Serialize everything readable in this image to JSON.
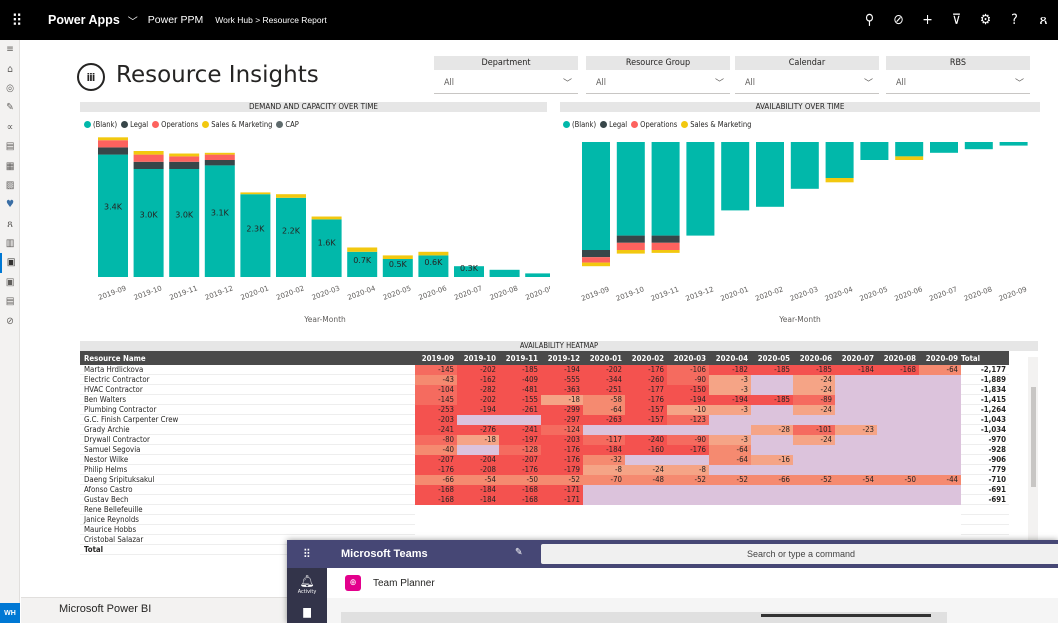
{
  "topbar": {
    "app_name": "Power Apps",
    "app_chevron": "chevron-down-icon",
    "env_name": "Power PPM",
    "breadcrumb": "Work Hub > Resource Report",
    "icons": [
      "search-icon",
      "status-icon",
      "add-icon",
      "filter-icon",
      "gear-icon",
      "help-icon",
      "user-icon"
    ]
  },
  "leftnav": {
    "icons": [
      "hamburger-icon",
      "home-icon",
      "recent-icon",
      "edit-icon",
      "connections-icon",
      "list-icon",
      "grid-icon",
      "image-icon",
      "heart-icon",
      "person-icon",
      "report-icon",
      "report-icon-active",
      "report-icon-2",
      "doc-icon",
      "check-icon"
    ],
    "avatar": "WH"
  },
  "report": {
    "title": "Resource Insights",
    "filters": [
      {
        "label": "Department",
        "value": "All"
      },
      {
        "label": "Resource Group",
        "value": "All"
      },
      {
        "label": "Calendar",
        "value": "All"
      },
      {
        "label": "RBS",
        "value": "All"
      }
    ]
  },
  "colors": {
    "blank": "#01b8aa",
    "legal": "#374649",
    "operations": "#fd625e",
    "sales": "#f2c80f",
    "cap": "#5f6b6d"
  },
  "chart_data": [
    {
      "type": "bar",
      "title": "DEMAND AND CAPACITY OVER TIME",
      "xlabel": "Year-Month",
      "legend": [
        "(Blank)",
        "Legal",
        "Operations",
        "Sales & Marketing",
        "CAP"
      ],
      "categories": [
        "2019-09",
        "2019-10",
        "2019-11",
        "2019-12",
        "2020-01",
        "2020-02",
        "2020-03",
        "2020-04",
        "2020-05",
        "2020-06",
        "2020-07",
        "2020-08",
        "2020-09"
      ],
      "series": [
        {
          "name": "(Blank)",
          "values": [
            3.4,
            3.0,
            3.0,
            3.1,
            2.3,
            2.2,
            1.6,
            0.7,
            0.5,
            0.6,
            0.3,
            0.2,
            0.1
          ]
        },
        {
          "name": "Legal",
          "values": [
            0.2,
            0.2,
            0.2,
            0.15,
            0,
            0,
            0,
            0,
            0,
            0,
            0,
            0,
            0
          ]
        },
        {
          "name": "Operations",
          "values": [
            0.2,
            0.2,
            0.15,
            0.15,
            0,
            0,
            0,
            0,
            0,
            0,
            0,
            0,
            0
          ]
        },
        {
          "name": "Sales & Marketing",
          "values": [
            0.08,
            0.1,
            0.08,
            0.05,
            0.05,
            0.1,
            0.08,
            0.12,
            0.1,
            0.1,
            0,
            0,
            0
          ]
        }
      ],
      "data_labels": [
        "3.4K",
        "3.0K",
        "3.0K",
        "3.1K",
        "2.3K",
        "2.2K",
        "1.6K",
        "0.7K",
        "0.5K",
        "0.6K",
        "0.3K",
        "",
        ""
      ]
    },
    {
      "type": "bar",
      "title": "AVAILABILITY OVER TIME",
      "xlabel": "Year-Month",
      "legend": [
        "(Blank)",
        "Legal",
        "Operations",
        "Sales & Marketing"
      ],
      "categories": [
        "2019-09",
        "2019-10",
        "2019-11",
        "2019-12",
        "2020-01",
        "2020-02",
        "2020-03",
        "2020-04",
        "2020-05",
        "2020-06",
        "2020-07",
        "2020-08",
        "2020-09"
      ],
      "series": [
        {
          "name": "(Blank)",
          "values": [
            -3.0,
            -2.6,
            -2.6,
            -2.6,
            -1.9,
            -1.8,
            -1.3,
            -1.0,
            -0.5,
            -0.4,
            -0.3,
            -0.2,
            -0.1
          ]
        },
        {
          "name": "Legal",
          "values": [
            -0.2,
            -0.2,
            -0.2,
            0,
            0,
            0,
            0,
            0,
            0,
            0,
            0,
            0,
            0
          ]
        },
        {
          "name": "Operations",
          "values": [
            -0.15,
            -0.2,
            -0.2,
            0,
            0,
            0,
            0,
            0,
            0,
            0,
            0,
            0,
            0
          ]
        },
        {
          "name": "Sales & Marketing",
          "values": [
            -0.1,
            -0.1,
            -0.08,
            0,
            0,
            0,
            0,
            -0.12,
            0,
            -0.1,
            0,
            0,
            0
          ]
        }
      ]
    }
  ],
  "heatmap": {
    "title": "AVAILABILITY HEATMAP",
    "header_name": "Resource Name",
    "months": [
      "2019-09",
      "2019-10",
      "2019-11",
      "2019-12",
      "2020-01",
      "2020-02",
      "2020-03",
      "2020-04",
      "2020-05",
      "2020-06",
      "2020-07",
      "2020-08",
      "2020-09"
    ],
    "total_label": "Total",
    "rows": [
      {
        "name": "Marta Hrdlickova",
        "values": [
          "-145",
          "-202",
          "-185",
          "-194",
          "-202",
          "-176",
          "-106",
          "-182",
          "-185",
          "-185",
          "-184",
          "-168",
          "-64"
        ],
        "total": "-2,177"
      },
      {
        "name": "Electric Contractor",
        "values": [
          "-43",
          "-162",
          "-409",
          "-555",
          "-344",
          "-260",
          "-90",
          "-3",
          "",
          "-24",
          "",
          "",
          ""
        ],
        "total": "-1,889"
      },
      {
        "name": "HVAC Contractor",
        "values": [
          "-104",
          "-282",
          "-481",
          "-363",
          "-251",
          "-177",
          "-150",
          "-3",
          "",
          "-24",
          "",
          "",
          ""
        ],
        "total": "-1,834"
      },
      {
        "name": "Ben Walters",
        "values": [
          "-145",
          "-202",
          "-155",
          "-18",
          "-58",
          "-176",
          "-194",
          "-194",
          "-185",
          "-89",
          "",
          "",
          ""
        ],
        "total": "-1,415"
      },
      {
        "name": "Plumbing Contractor",
        "values": [
          "-253",
          "-194",
          "-261",
          "-299",
          "-64",
          "-157",
          "-10",
          "-3",
          "",
          "-24",
          "",
          "",
          ""
        ],
        "total": "-1,264"
      },
      {
        "name": "G.C. Finish Carpenter Crew",
        "values": [
          "-203",
          "",
          "",
          "-297",
          "-263",
          "-157",
          "-123",
          "",
          "",
          "",
          "",
          "",
          ""
        ],
        "total": "-1,043"
      },
      {
        "name": "Grady Archie",
        "values": [
          "-241",
          "-276",
          "-241",
          "-124",
          "",
          "",
          "",
          "",
          "-28",
          "-101",
          "-23",
          "",
          ""
        ],
        "total": "-1,034"
      },
      {
        "name": "Drywall Contractor",
        "values": [
          "-80",
          "-18",
          "-197",
          "-203",
          "-117",
          "-240",
          "-90",
          "-3",
          "",
          "-24",
          "",
          "",
          ""
        ],
        "total": "-970"
      },
      {
        "name": "Samuel Segovia",
        "values": [
          "-40",
          "",
          "-128",
          "-176",
          "-184",
          "-160",
          "-176",
          "-64",
          "",
          "",
          "",
          "",
          ""
        ],
        "total": "-928"
      },
      {
        "name": "Nestor Wilke",
        "values": [
          "-207",
          "-204",
          "-207",
          "-176",
          "-32",
          "",
          "",
          "-64",
          "-16",
          "",
          "",
          "",
          ""
        ],
        "total": "-906"
      },
      {
        "name": "Philip Helms",
        "values": [
          "-176",
          "-208",
          "-176",
          "-179",
          "-8",
          "-24",
          "-8",
          "",
          "",
          "",
          "",
          "",
          ""
        ],
        "total": "-779"
      },
      {
        "name": "Daeng Sripituksakul",
        "values": [
          "-66",
          "-54",
          "-50",
          "-52",
          "-70",
          "-48",
          "-52",
          "-52",
          "-66",
          "-52",
          "-54",
          "-50",
          "-44"
        ],
        "total": "-710"
      },
      {
        "name": "Afonso Castro",
        "values": [
          "-168",
          "-184",
          "-168",
          "-171",
          "",
          "",
          "",
          "",
          "",
          "",
          "",
          "",
          ""
        ],
        "total": "-691"
      },
      {
        "name": "Gustav Bech",
        "values": [
          "-168",
          "-184",
          "-168",
          "-171",
          "",
          "",
          "",
          "",
          "",
          "",
          "",
          "",
          ""
        ],
        "total": "-691"
      },
      {
        "name": "Rene Bellefeuille",
        "values": [
          "",
          "",
          "",
          "",
          "",
          "",
          "",
          "",
          "",
          "",
          "",
          "",
          ""
        ],
        "total": ""
      },
      {
        "name": "Janice Reynolds",
        "values": [
          "",
          "",
          "",
          "",
          "",
          "",
          "",
          "",
          "",
          "",
          "",
          "",
          ""
        ],
        "total": ""
      },
      {
        "name": "Maurice Hobbs",
        "values": [
          "",
          "",
          "",
          "",
          "",
          "",
          "",
          "",
          "",
          "",
          "",
          "",
          ""
        ],
        "total": ""
      },
      {
        "name": "Cristobal Salazar",
        "values": [
          "",
          "",
          "",
          "",
          "",
          "",
          "",
          "",
          "",
          "",
          "",
          "",
          ""
        ],
        "total": ""
      }
    ],
    "footer_label": "Total"
  },
  "bottombar": {
    "label": "Microsoft Power BI"
  },
  "teams": {
    "app_name": "Microsoft Teams",
    "search_placeholder": "Search or type a command",
    "rail_activity": "Activity",
    "tab_title": "Team Planner"
  }
}
